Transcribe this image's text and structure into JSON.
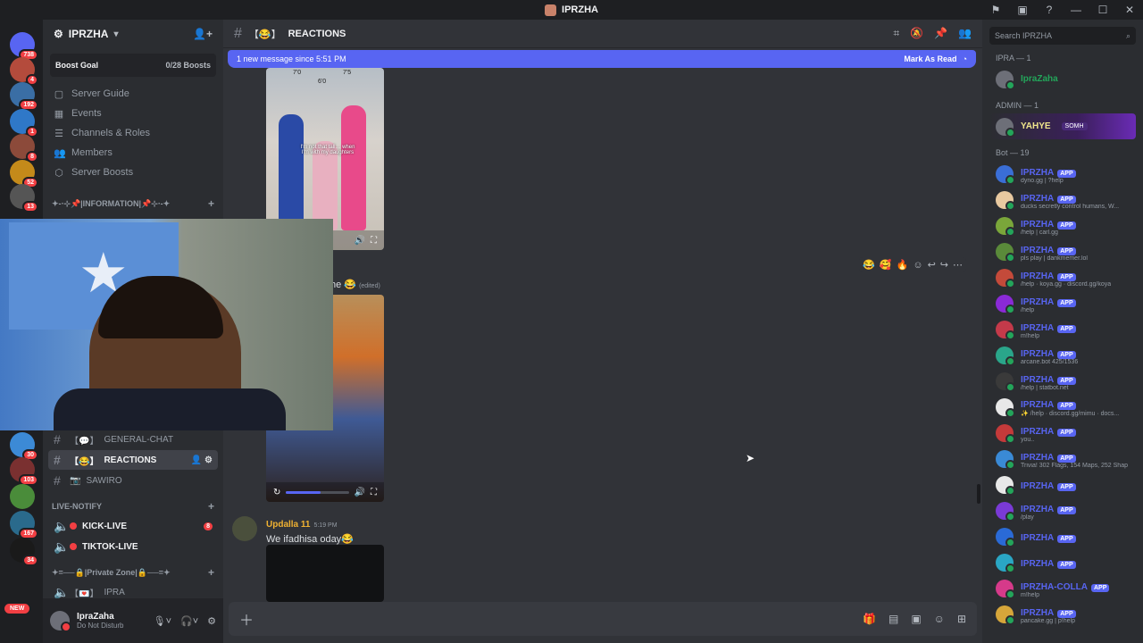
{
  "window": {
    "title": "IPRZHA",
    "controls": [
      "⚑",
      "▣",
      "?",
      "—",
      "☐",
      "✕"
    ]
  },
  "rail": {
    "servers": [
      {
        "badge": "738",
        "color": "#5865f2"
      },
      {
        "badge": "4",
        "color": "#b44b3c"
      },
      {
        "badge": "192",
        "color": "#3a6ea5"
      },
      {
        "badge": "1",
        "color": "#2f78c8"
      },
      {
        "badge": "8",
        "color": "#8c4a3a"
      },
      {
        "badge": "52",
        "color": "#c48a1a"
      },
      {
        "badge": "13",
        "color": "#555"
      },
      {
        "badge": "30",
        "color": "#3c8ad6"
      },
      {
        "badge": "103",
        "color": "#7a3030"
      },
      {
        "badge": "",
        "color": "#4a8c3a"
      },
      {
        "badge": "167",
        "color": "#2a6a8c"
      },
      {
        "badge": "34",
        "color": "#1a1a1a"
      }
    ],
    "new_label": "NEW"
  },
  "sidebar": {
    "server_name": "IPRZHA",
    "boost": {
      "label": "Boost Goal",
      "count": "0/28 Boosts"
    },
    "nav": [
      {
        "label": "Server Guide",
        "icon": "▢"
      },
      {
        "label": "Events",
        "icon": "▦"
      },
      {
        "label": "Channels & Roles",
        "icon": "☰"
      },
      {
        "label": "Members",
        "icon": "👥"
      },
      {
        "label": "Server Boosts",
        "icon": "⬡"
      }
    ],
    "cat_information": "✦-‧⊹📌|INFORMATION|📌⊹‧-✦",
    "channels": [
      {
        "emoji": "【💬】",
        "label": "GENERAL-CHAT"
      },
      {
        "emoji": "【😂】",
        "label": "REACTIONS"
      },
      {
        "emoji": "📷",
        "label": "SAWIRO"
      }
    ],
    "cat_live": "LIVE-NOTIFY",
    "live_channels": [
      {
        "label": "KICK-LIVE",
        "count": "8"
      },
      {
        "label": "TIKTOK-LIVE",
        "count": ""
      }
    ],
    "cat_private": "✦=──🔒|Private Zone|🔒──=✦",
    "private_channel": {
      "emoji": "【💌】",
      "label": "IPRA"
    },
    "user": {
      "name": "IpraZaha",
      "status": "Do Not Disturb"
    }
  },
  "main": {
    "channel_emoji": "【😂】",
    "channel_name": "REACTIONS",
    "new_message_bar": {
      "text": "1 new message since 5:51 PM",
      "action": "Mark As Read"
    },
    "media1": {
      "caption": "I'm not that tall… when I'm with my daughters",
      "heights": [
        "7'0",
        "6'0",
        "7'5"
      ]
    },
    "msg2": {
      "text": "he 😂",
      "edited": "(edited)"
    },
    "hover_reactions": [
      "😂",
      "🥰",
      "🔥"
    ],
    "media2_progress": 0.55,
    "msg3": {
      "author": "Updalla 11",
      "time": "5:19 PM",
      "text": "We ifadhisa oday😂"
    }
  },
  "members": {
    "search_placeholder": "Search IPRZHA",
    "group_owner": "IPRA — 1",
    "owner": "IpraZaha",
    "group_admin": "ADMIN — 1",
    "admin": {
      "name": "YAHYE",
      "tag": "SOMH"
    },
    "group_bot": "Bot — 19",
    "bots": [
      {
        "name": "IPRZHA",
        "sub": "dyno.gg | ?help",
        "color": "#3a6ed6"
      },
      {
        "name": "IPRZHA",
        "sub": "ducks secretly control humans, W...",
        "color": "#e8c9a0"
      },
      {
        "name": "IPRZHA",
        "sub": "/help | carl.gg",
        "color": "#7aa63a"
      },
      {
        "name": "IPRZHA",
        "sub": "pls play | dankmemer.lol",
        "color": "#5a8a3a"
      },
      {
        "name": "IPRZHA",
        "sub": "/help · koya.gg · discord.gg/koya",
        "color": "#c44a3a"
      },
      {
        "name": "IPRZHA",
        "sub": "/help",
        "color": "#8a2ad6"
      },
      {
        "name": "IPRZHA",
        "sub": "m!help",
        "color": "#c43a4a"
      },
      {
        "name": "IPRZHA",
        "sub": "arcane.bot 425/1536",
        "color": "#2aa68a"
      },
      {
        "name": "IPRZHA",
        "sub": "/help | statbot.net",
        "color": "#3a3a3a"
      },
      {
        "name": "IPRZHA",
        "sub": "✨ /help · discord.gg/mimu · docs...",
        "color": "#e8e8e8"
      },
      {
        "name": "IPRZHA",
        "sub": "you..",
        "color": "#c43a3a"
      },
      {
        "name": "IPRZHA",
        "sub": "Trivia! 302 Flags, 154 Maps, 252 Shap",
        "color": "#3a8ad6"
      },
      {
        "name": "IPRZHA",
        "sub": "",
        "color": "#e8e8e8"
      },
      {
        "name": "IPRZHA",
        "sub": "/play",
        "color": "#7a3ad6"
      },
      {
        "name": "IPRZHA",
        "sub": "",
        "color": "#2a6ad6"
      },
      {
        "name": "IPRZHA",
        "sub": "",
        "color": "#2aa6c4"
      },
      {
        "name": "IPRZHA-COLLA",
        "sub": "m!help",
        "color": "#d63a8a"
      },
      {
        "name": "IPRZHA",
        "sub": "pancake.gg | p!help",
        "color": "#d6a63a"
      }
    ],
    "app_label": "APP"
  }
}
